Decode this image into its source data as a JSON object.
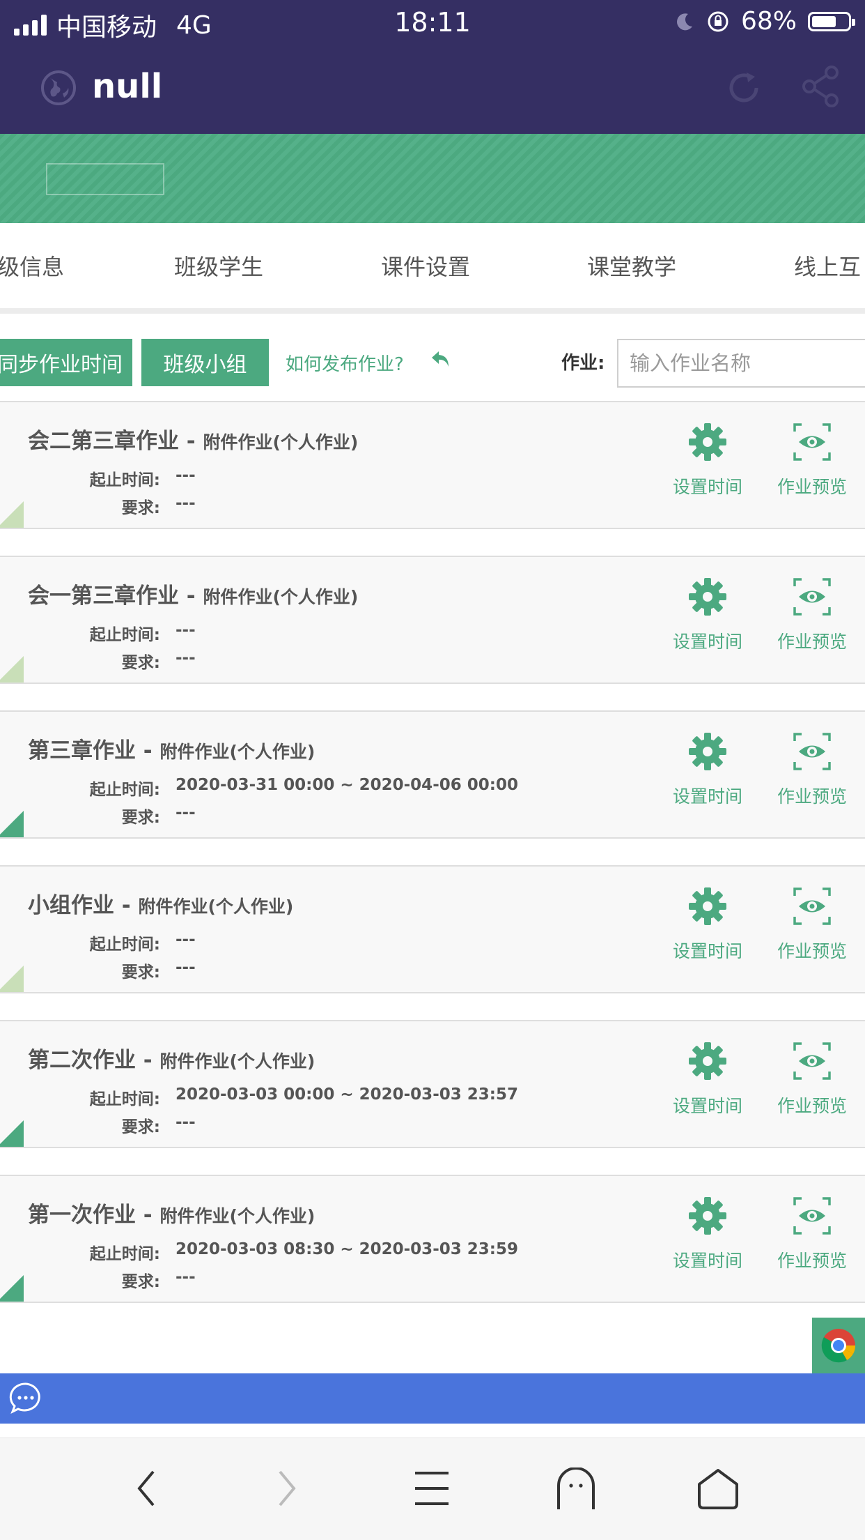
{
  "status": {
    "carrier": "中国移动",
    "network": "4G",
    "time": "18:11",
    "battery": "68%",
    "battery_level": 0.68
  },
  "header": {
    "title": "null"
  },
  "tabs": [
    "级信息",
    "班级学生",
    "课件设置",
    "课堂教学",
    "线上互"
  ],
  "toolbar": {
    "sync_button": "同步作业时间",
    "group_button": "班级小组",
    "howto_link": "如何发布作业?",
    "search_label": "作业:",
    "search_placeholder": "输入作业名称"
  },
  "labels": {
    "time": "起止时间:",
    "requirement": "要求:",
    "set_time": "设置时间",
    "preview": "作业预览"
  },
  "assignments": [
    {
      "name": "会二第三章作业",
      "sep": " - ",
      "type": "附件作业(个人作业)",
      "time": "---",
      "requirement": "---",
      "corner": "light"
    },
    {
      "name": "会一第三章作业",
      "sep": " - ",
      "type": "附件作业(个人作业)",
      "time": "---",
      "requirement": "---",
      "corner": "light"
    },
    {
      "name": "第三章作业",
      "sep": " - ",
      "type": "附件作业(个人作业)",
      "time": "2020-03-31 00:00 ~ 2020-04-06 00:00",
      "requirement": "---",
      "corner": "dark"
    },
    {
      "name": "小组作业",
      "sep": " - ",
      "type": "附件作业(个人作业)",
      "time": "---",
      "requirement": "---",
      "corner": "light"
    },
    {
      "name": "第二次作业",
      "sep": " - ",
      "type": "附件作业(个人作业)",
      "time": "2020-03-03 00:00 ~ 2020-03-03 23:57",
      "requirement": "---",
      "corner": "dark"
    },
    {
      "name": "第一次作业",
      "sep": " - ",
      "type": "附件作业(个人作业)",
      "time": "2020-03-03 08:30 ~ 2020-03-03 23:59",
      "requirement": "---",
      "corner": "dark"
    }
  ],
  "icons": {
    "globe": "globe-icon",
    "refresh": "refresh-icon",
    "share": "share-icon",
    "gear": "gear-icon",
    "eye": "eye-icon",
    "chrome": "chrome-icon",
    "chat": "chat-icon"
  },
  "colors": {
    "header_bg": "#352f63",
    "accent_green": "#4ca980",
    "chat_blue": "#4a74dc"
  }
}
